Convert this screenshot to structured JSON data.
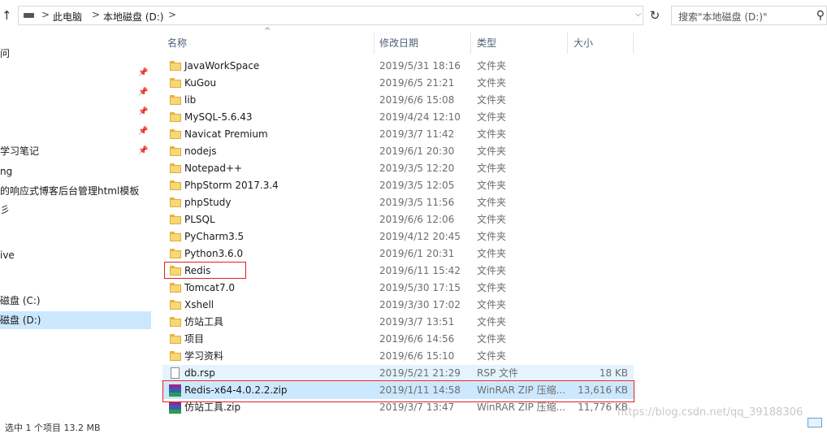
{
  "address": {
    "crumbs": [
      "此电脑",
      "本地磁盘 (D:)"
    ],
    "separator": ">",
    "search_placeholder": "搜索\"本地磁盘 (D:)\""
  },
  "nav": {
    "items": [
      {
        "label": "问",
        "pinned": false
      },
      {
        "label": "",
        "pinned": true
      },
      {
        "label": "",
        "pinned": true
      },
      {
        "label": "",
        "pinned": true
      },
      {
        "label": "",
        "pinned": true
      },
      {
        "label": "学习笔记",
        "pinned": true
      },
      {
        "label": "ng",
        "pinned": false
      },
      {
        "label": "的响应式博客后台管理html模板",
        "pinned": false
      },
      {
        "label": "彡",
        "pinned": false
      },
      {
        "label": "ive",
        "pinned": false
      },
      {
        "label": "磁盘 (C:)",
        "pinned": false
      },
      {
        "label": "磁盘 (D:)",
        "pinned": false,
        "selected": true
      }
    ]
  },
  "columns": {
    "name": "名称",
    "date": "修改日期",
    "type": "类型",
    "size": "大小"
  },
  "files": [
    {
      "name": "JavaWorkSpace",
      "date": "2019/5/31 18:16",
      "type": "文件夹",
      "size": "",
      "icon": "folder"
    },
    {
      "name": "KuGou",
      "date": "2019/6/5 21:21",
      "type": "文件夹",
      "size": "",
      "icon": "folder"
    },
    {
      "name": "lib",
      "date": "2019/6/6 15:08",
      "type": "文件夹",
      "size": "",
      "icon": "folder"
    },
    {
      "name": "MySQL-5.6.43",
      "date": "2019/4/24 12:10",
      "type": "文件夹",
      "size": "",
      "icon": "folder"
    },
    {
      "name": "Navicat Premium",
      "date": "2019/3/7 11:42",
      "type": "文件夹",
      "size": "",
      "icon": "folder"
    },
    {
      "name": "nodejs",
      "date": "2019/6/1 20:30",
      "type": "文件夹",
      "size": "",
      "icon": "folder"
    },
    {
      "name": "Notepad++",
      "date": "2019/3/5 12:20",
      "type": "文件夹",
      "size": "",
      "icon": "folder"
    },
    {
      "name": "PhpStorm 2017.3.4",
      "date": "2019/3/5 12:05",
      "type": "文件夹",
      "size": "",
      "icon": "folder"
    },
    {
      "name": "phpStudy",
      "date": "2019/3/5 11:56",
      "type": "文件夹",
      "size": "",
      "icon": "folder"
    },
    {
      "name": "PLSQL",
      "date": "2019/6/6 12:06",
      "type": "文件夹",
      "size": "",
      "icon": "folder"
    },
    {
      "name": "PyCharm3.5",
      "date": "2019/4/12 20:45",
      "type": "文件夹",
      "size": "",
      "icon": "folder"
    },
    {
      "name": "Python3.6.0",
      "date": "2019/6/1 20:31",
      "type": "文件夹",
      "size": "",
      "icon": "folder"
    },
    {
      "name": "Redis",
      "date": "2019/6/11 15:42",
      "type": "文件夹",
      "size": "",
      "icon": "folder"
    },
    {
      "name": "Tomcat7.0",
      "date": "2019/5/30 17:15",
      "type": "文件夹",
      "size": "",
      "icon": "folder"
    },
    {
      "name": "Xshell",
      "date": "2019/3/30 17:02",
      "type": "文件夹",
      "size": "",
      "icon": "folder"
    },
    {
      "name": "仿站工具",
      "date": "2019/3/7 13:51",
      "type": "文件夹",
      "size": "",
      "icon": "folder"
    },
    {
      "name": "项目",
      "date": "2019/6/6 14:56",
      "type": "文件夹",
      "size": "",
      "icon": "folder"
    },
    {
      "name": "学习资料",
      "date": "2019/6/6 15:10",
      "type": "文件夹",
      "size": "",
      "icon": "folder"
    },
    {
      "name": "db.rsp",
      "date": "2019/5/21 21:29",
      "type": "RSP 文件",
      "size": "18 KB",
      "icon": "file",
      "state": "hover"
    },
    {
      "name": "Redis-x64-4.0.2.2.zip",
      "date": "2019/1/11 14:58",
      "type": "WinRAR ZIP 压缩...",
      "size": "13,616 KB",
      "icon": "rar",
      "state": "selected"
    },
    {
      "name": "仿站工具.zip",
      "date": "2019/3/7 13:47",
      "type": "WinRAR ZIP 压缩...",
      "size": "11,776 KB",
      "icon": "rar"
    }
  ],
  "status": {
    "text": "选中 1 个项目  13.2 MB"
  },
  "watermark": "https://blog.csdn.net/qq_39188306",
  "colors": {
    "selected_bg": "#cce8ff",
    "hover_bg": "#e5f3ff",
    "highlight_border": "#e02020",
    "folder": "#f8d775"
  }
}
